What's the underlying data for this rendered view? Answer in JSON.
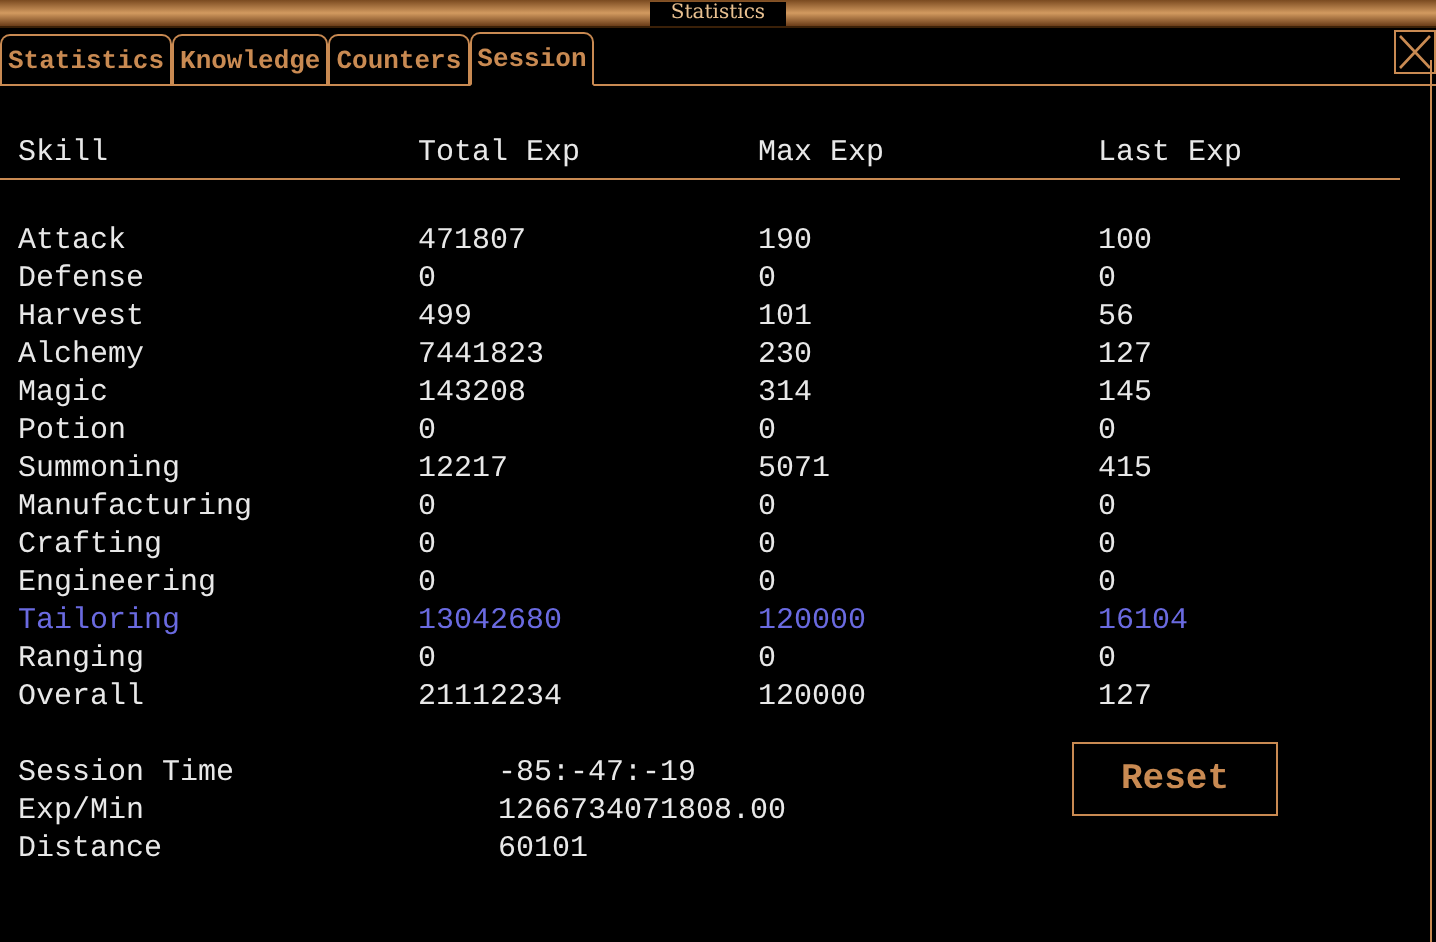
{
  "window": {
    "title": "Statistics"
  },
  "tabs": [
    {
      "label": "Statistics",
      "selected": false
    },
    {
      "label": "Knowledge",
      "selected": false
    },
    {
      "label": "Counters",
      "selected": false
    },
    {
      "label": "Session",
      "selected": true
    }
  ],
  "table": {
    "columns": [
      "Skill",
      "Total Exp",
      "Max Exp",
      "Last Exp"
    ],
    "rows": [
      {
        "cells": [
          "Attack",
          "471807",
          "190",
          "100"
        ],
        "selected": false
      },
      {
        "cells": [
          "Defense",
          "0",
          "0",
          "0"
        ],
        "selected": false
      },
      {
        "cells": [
          "Harvest",
          "499",
          "101",
          "56"
        ],
        "selected": false
      },
      {
        "cells": [
          "Alchemy",
          "7441823",
          "230",
          "127"
        ],
        "selected": false
      },
      {
        "cells": [
          "Magic",
          "143208",
          "314",
          "145"
        ],
        "selected": false
      },
      {
        "cells": [
          "Potion",
          "0",
          "0",
          "0"
        ],
        "selected": false
      },
      {
        "cells": [
          "Summoning",
          "12217",
          "5071",
          "415"
        ],
        "selected": false
      },
      {
        "cells": [
          "Manufacturing",
          "0",
          "0",
          "0"
        ],
        "selected": false
      },
      {
        "cells": [
          "Crafting",
          "0",
          "0",
          "0"
        ],
        "selected": false
      },
      {
        "cells": [
          "Engineering",
          "0",
          "0",
          "0"
        ],
        "selected": false
      },
      {
        "cells": [
          "Tailoring",
          "13042680",
          "120000",
          "16104"
        ],
        "selected": true
      },
      {
        "cells": [
          "Ranging",
          "0",
          "0",
          "0"
        ],
        "selected": false
      },
      {
        "cells": [
          "Overall",
          "21112234",
          "120000",
          "127"
        ],
        "selected": false
      }
    ]
  },
  "session": [
    {
      "label": "Session Time",
      "value": "-85:-47:-19"
    },
    {
      "label": "Exp/Min",
      "value": "1266734071808.00"
    },
    {
      "label": "Distance",
      "value": "60101"
    }
  ],
  "reset_button": "Reset"
}
